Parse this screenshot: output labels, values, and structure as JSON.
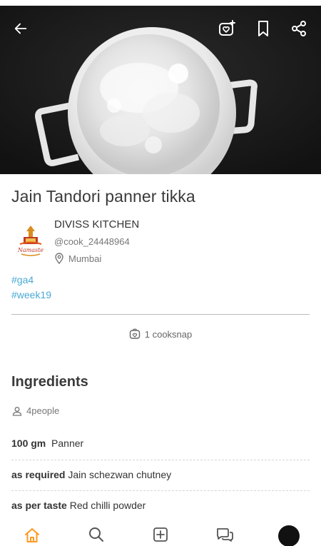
{
  "recipe": {
    "title": "Jain Tandori panner tikka"
  },
  "author": {
    "name": "DIVISS KITCHEN",
    "handle": "@cook_24448964",
    "location": "Mumbai",
    "avatar_logo_text": "Namaste"
  },
  "tags": [
    "#ga4",
    "#week19"
  ],
  "cooksnap": {
    "label": "1 cooksnap"
  },
  "ingredients": {
    "heading": "Ingredients",
    "servings": "4people",
    "items": [
      {
        "qty": "100 gm",
        "name": "Panner"
      },
      {
        "qty": "as required",
        "name": "Jain schezwan chutney"
      },
      {
        "qty": "as per taste",
        "name": "Red chilli powder"
      }
    ]
  },
  "icons": {
    "back": "back-arrow-icon",
    "cooksnap_add": "cooksnap-add-icon",
    "bookmark": "bookmark-icon",
    "share": "share-icon",
    "location": "location-pin-icon",
    "person": "person-icon",
    "home": "home-icon",
    "search": "search-icon",
    "add": "add-icon",
    "chat": "chat-icon"
  },
  "colors": {
    "accent": "#ff9a1f",
    "tag": "#4aa9d6",
    "hero_bg": "#1b1b1b"
  }
}
